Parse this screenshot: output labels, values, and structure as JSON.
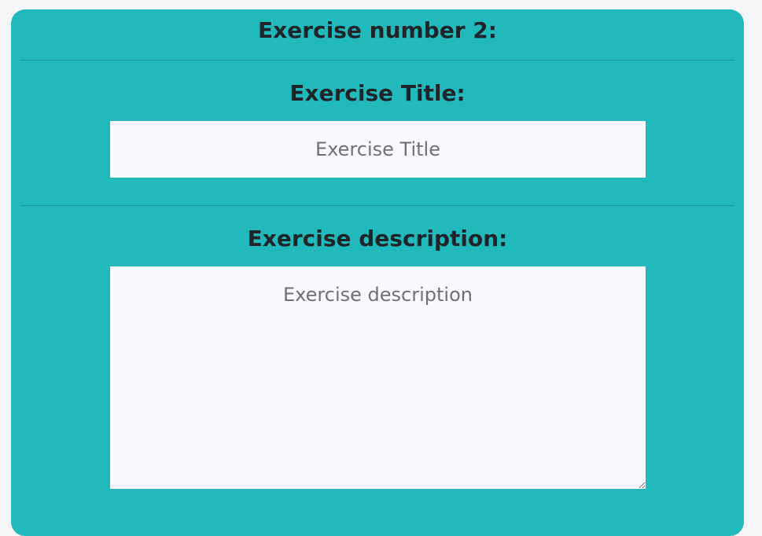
{
  "exercise": {
    "heading": "Exercise number 2:",
    "title_label": "Exercise Title:",
    "title_placeholder": "Exercise Title",
    "title_value": "",
    "description_label": "Exercise description:",
    "description_placeholder": "Exercise description",
    "description_value": ""
  },
  "colors": {
    "card_background": "#22b9bc",
    "page_background": "#f7f7fa",
    "field_background": "#fcf8ff",
    "heading_text": "#1f2428"
  }
}
